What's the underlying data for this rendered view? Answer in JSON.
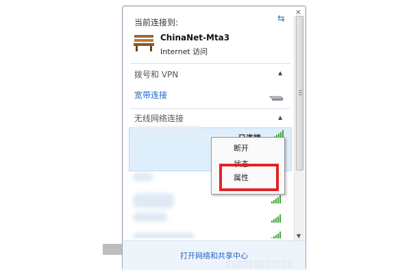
{
  "panel": {
    "current_label": "当前连接到:",
    "network_name": "ChinaNet-Mta3",
    "network_access": "Internet 访问"
  },
  "sections": {
    "dialup_title": "拨号和 VPN",
    "broadband_label": "宽带连接",
    "wireless_title": "无线网络连接"
  },
  "wifi": {
    "connected_label": "已连接"
  },
  "context_menu": {
    "items": [
      "断开",
      "状态",
      "属性"
    ]
  },
  "footer": {
    "link_label": "打开网络和共享中心"
  },
  "icons": {
    "refresh": "refresh-icon",
    "bench": "bench-network-icon",
    "modem": "modem-icon",
    "signal": "wifi-signal-icon",
    "close": "close-icon"
  },
  "colors": {
    "link": "#1c65c5",
    "signal": "#3ea53e",
    "highlight_box": "#e42121",
    "selected_row": "#dfeefb"
  }
}
